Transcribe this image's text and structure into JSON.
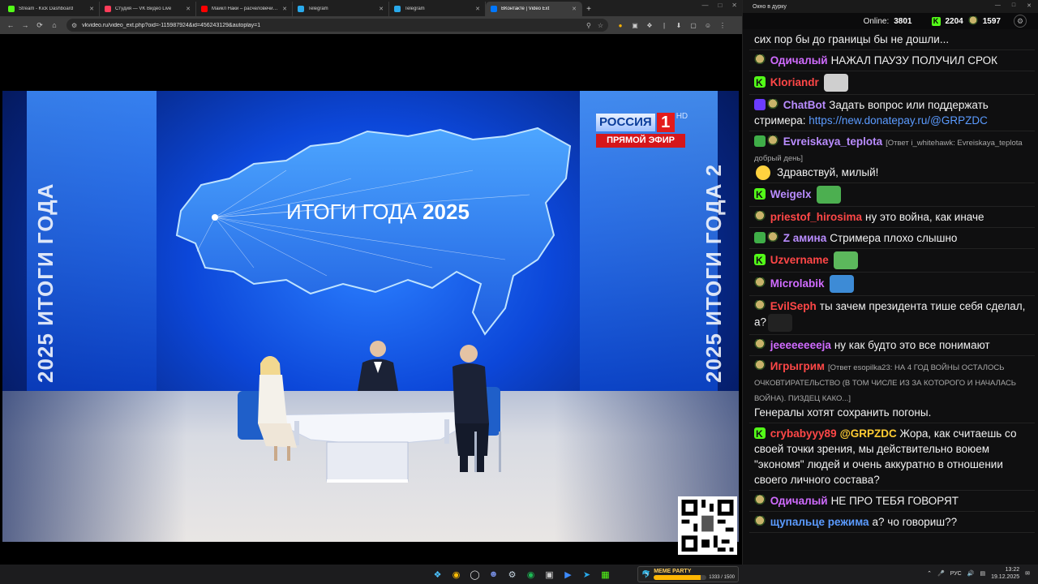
{
  "browser": {
    "tabs": [
      {
        "title": "Stream - Kick Dashboard",
        "color": "#53fc18",
        "active": false
      },
      {
        "title": "Студия — VK Видео Live",
        "color": "#ff3d5a",
        "active": false
      },
      {
        "title": "Майкл Наки – расчеловечива...",
        "color": "#ff0000",
        "active": false
      },
      {
        "title": "Telegram",
        "color": "#29a9eb",
        "active": false
      },
      {
        "title": "Telegram",
        "color": "#29a9eb",
        "active": false
      },
      {
        "title": "ВКонтакте | Video Ext",
        "color": "#0077ff",
        "active": true
      }
    ],
    "url": "vkvideo.ru/video_ext.php?oid=-115987924&id=456243129&autoplay=1"
  },
  "video": {
    "headline": "ИТОГИ ГОДА",
    "year": "2025",
    "side_text_left": "ИТОГИ ГОДА",
    "side_year_left": "2025",
    "side_text_right": "ИТОГИ ГОДА 2",
    "side_year_right": "2025",
    "channel": "РОССИЯ",
    "channel_number": "1",
    "hd": "HD",
    "live": "ПРЯМОЙ ЭФИР"
  },
  "chat": {
    "window_title": "Окно в дурку",
    "online_label": "Online:",
    "online_count": "3801",
    "kick_count": "2204",
    "vk_count": "1597",
    "messages": [
      {
        "badges": [],
        "user": "",
        "color": "#fff",
        "text": "сих пор бы до границы бы не дошли..."
      },
      {
        "badges": [
          "pepe"
        ],
        "user": "Одичалый",
        "color": "#d06bff",
        "text": "НАЖАЛ ПАУЗУ ПОЛУЧИЛ СРОК"
      },
      {
        "badges": [
          "kick"
        ],
        "user": "Kloriandr",
        "color": "#ff4747",
        "text": "",
        "emote": "#cfcfcf"
      },
      {
        "badges": [
          "bot",
          "pepe"
        ],
        "user": "ChatBot",
        "color": "#b98cff",
        "text": "Задать вопрос или поддержать стримера: ",
        "link": "https://new.donatepay.ru/@GRPZDC"
      },
      {
        "badges": [
          "tick",
          "pepe"
        ],
        "user": "Evreiskaya_teplota",
        "color": "#b98cff",
        "reply": "[Ответ i_whitehawk: Evreiskaya_teplota добрый день]",
        "text": "Здравствуй, милый!",
        "lead_emote": "#ffd23f"
      },
      {
        "badges": [
          "kick"
        ],
        "user": "Weigelx",
        "color": "#b98cff",
        "text": "",
        "emote": "#4caf50"
      },
      {
        "badges": [
          "pepe"
        ],
        "user": "priestof_hirosima",
        "color": "#ff4747",
        "text": "ну это война, как иначе"
      },
      {
        "badges": [
          "tick",
          "pepe"
        ],
        "user": "Z амина",
        "color": "#b98cff",
        "text": "Стримера плохо слышно"
      },
      {
        "badges": [
          "kick"
        ],
        "user": "Uzvername",
        "color": "#ff4747",
        "text": "",
        "emote": "#5cb85c"
      },
      {
        "badges": [
          "pepe"
        ],
        "user": "Microlabik",
        "color": "#d06bff",
        "text": "",
        "emote": "#3d8bd6"
      },
      {
        "badges": [
          "pepe"
        ],
        "user": "EvilSeph",
        "color": "#ff4747",
        "text": "ты зачем президента тише себя сделал, а?",
        "emote": "#222"
      },
      {
        "badges": [
          "pepe"
        ],
        "user": "jeeeeeeeeja",
        "color": "#d06bff",
        "text": "ну как будто это все понимают"
      },
      {
        "badges": [
          "pepe"
        ],
        "user": "Игрыгрим",
        "color": "#ff4747",
        "reply": "[Ответ esopilka23: НА 4 ГОД ВОЙНЫ ОСТАЛОСЬ ОЧКОВТИРАТЕЛЬСТВО (В ТОМ ЧИСЛЕ ИЗ ЗА КОТОРОГО И НАЧАЛАСЬ ВОЙНА). ПИЗДЕЦ КАКО...]",
        "text": "Генералы хотят сохранить погоны."
      },
      {
        "badges": [
          "kick"
        ],
        "user": "crybabyyy89",
        "color": "#ff4747",
        "mention": "@GRPZDC",
        "text": "Жора, как считаешь со своей точки зрения, мы действительно воюем \"экономя\" людей и очень аккуратно в отношении своего личного состава?"
      },
      {
        "badges": [
          "pepe"
        ],
        "user": "Одичалый",
        "color": "#d06bff",
        "text": "НЕ ПРО ТЕБЯ ГОВОРЯТ"
      },
      {
        "badges": [
          "pepe"
        ],
        "user": "щупальце режима",
        "color": "#5b9bff",
        "text": "а? чо говориш??"
      }
    ]
  },
  "taskbar": {
    "party_label": "MEME PARTY",
    "party_value": "1333 / 1500",
    "party_progress": 0.89,
    "lang": "РУС",
    "time": "13:22",
    "date": "19.12.2025"
  }
}
